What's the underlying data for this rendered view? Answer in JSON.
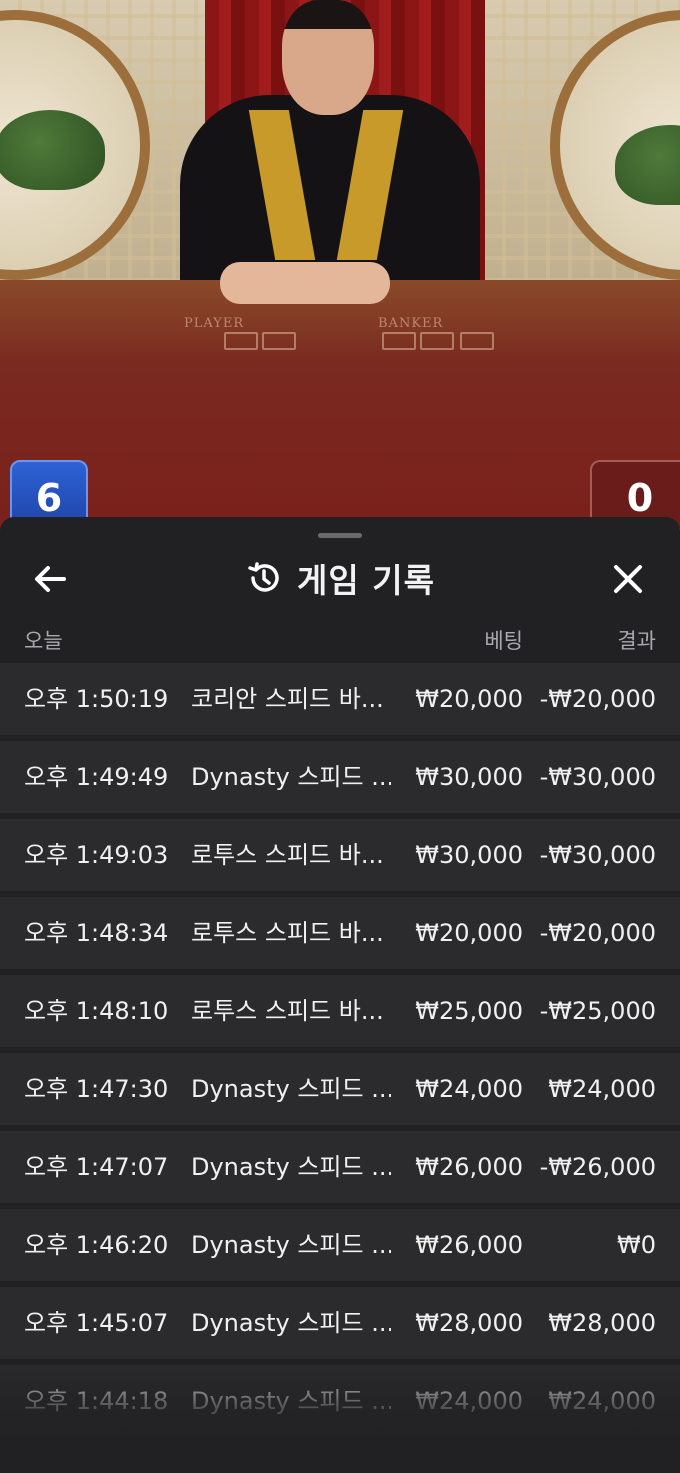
{
  "scene": {
    "player_label": "PLAYER",
    "banker_label": "BANKER",
    "player_score": "6",
    "banker_score": "0",
    "player_color": "#2e62d6",
    "banker_color": "#6a1c1a"
  },
  "header": {
    "title": "게임 기록",
    "back_icon": "arrow-left-icon",
    "history_icon": "history-clock-icon",
    "close_icon": "close-icon"
  },
  "columns": {
    "date": "오늘",
    "bet": "베팅",
    "result": "결과"
  },
  "rows": [
    {
      "time": "오후 1:50:19",
      "game": "코리안 스피드 바...",
      "bet": "₩20,000",
      "result": "-₩20,000"
    },
    {
      "time": "오후 1:49:49",
      "game": "Dynasty 스피드 ...",
      "bet": "₩30,000",
      "result": "-₩30,000"
    },
    {
      "time": "오후 1:49:03",
      "game": "로투스 스피드 바...",
      "bet": "₩30,000",
      "result": "-₩30,000"
    },
    {
      "time": "오후 1:48:34",
      "game": "로투스 스피드 바...",
      "bet": "₩20,000",
      "result": "-₩20,000"
    },
    {
      "time": "오후 1:48:10",
      "game": "로투스 스피드 바...",
      "bet": "₩25,000",
      "result": "-₩25,000"
    },
    {
      "time": "오후 1:47:30",
      "game": "Dynasty 스피드 ...",
      "bet": "₩24,000",
      "result": "₩24,000"
    },
    {
      "time": "오후 1:47:07",
      "game": "Dynasty 스피드 ...",
      "bet": "₩26,000",
      "result": "-₩26,000"
    },
    {
      "time": "오후 1:46:20",
      "game": "Dynasty 스피드 ...",
      "bet": "₩26,000",
      "result": "₩0"
    },
    {
      "time": "오후 1:45:07",
      "game": "Dynasty 스피드 ...",
      "bet": "₩28,000",
      "result": "₩28,000"
    },
    {
      "time": "오후 1:44:18",
      "game": "Dynasty 스피드 ...",
      "bet": "₩24,000",
      "result": "₩24,000"
    }
  ]
}
